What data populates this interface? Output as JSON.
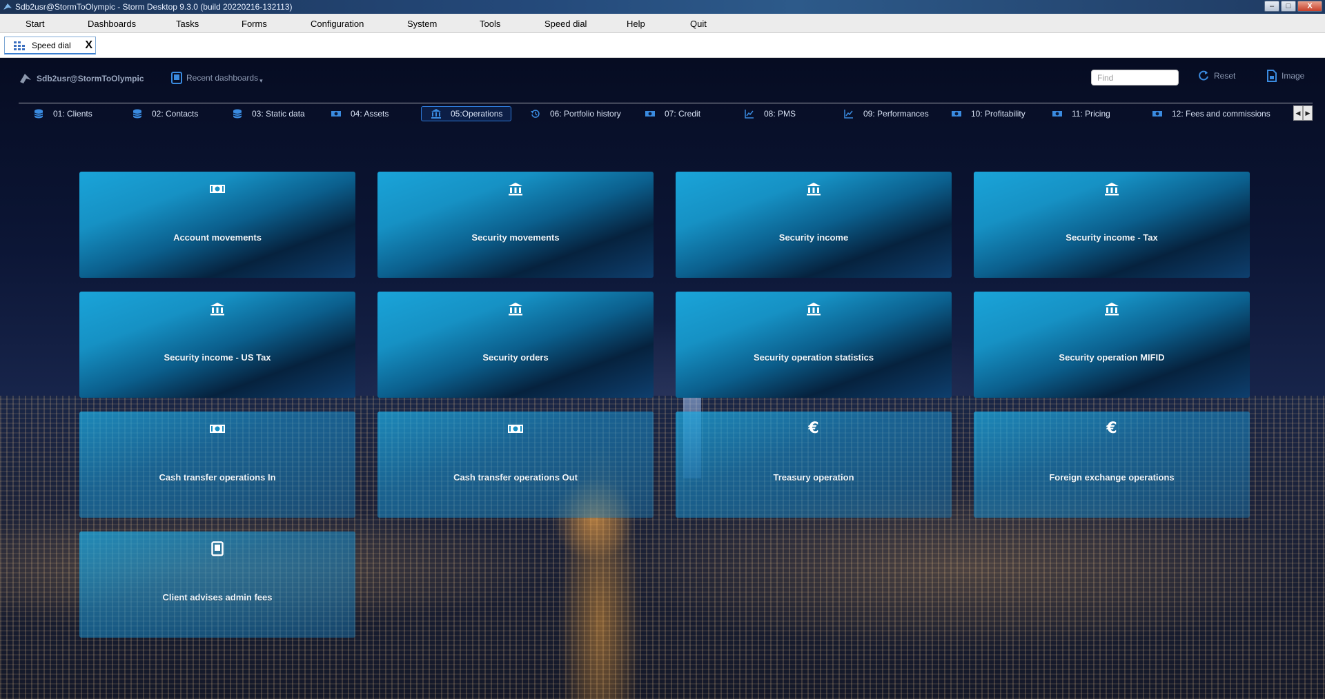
{
  "window": {
    "title": "Sdb2usr@StormToOlympic -  Storm Desktop 9.3.0 (build 20220216-132113)",
    "controls": {
      "minimize": "–",
      "maximize": "□",
      "close": "X"
    }
  },
  "menu": {
    "items": [
      "Start",
      "Dashboards",
      "Tasks",
      "Forms",
      "Configuration",
      "System",
      "Tools",
      "Speed dial",
      "Help",
      "Quit"
    ]
  },
  "doc_tab": {
    "label": "Speed dial",
    "close": "X"
  },
  "header": {
    "user": "Sdb2usr@StormToOlympic",
    "recent_dashboards": "Recent dashboards",
    "find_placeholder": "Find",
    "reset": "Reset",
    "image": "Image"
  },
  "dashboard_tabs": [
    {
      "label": "01: Clients",
      "icon": "database-icon"
    },
    {
      "label": "02: Contacts",
      "icon": "database-icon"
    },
    {
      "label": "03: Static data",
      "icon": "database-icon"
    },
    {
      "label": "04: Assets",
      "icon": "money-icon"
    },
    {
      "label": "05:Operations",
      "icon": "bank-icon",
      "active": true
    },
    {
      "label": "06: Portfolio history",
      "icon": "history-icon"
    },
    {
      "label": "07: Credit",
      "icon": "money-icon"
    },
    {
      "label": "08: PMS",
      "icon": "chart-icon"
    },
    {
      "label": "09: Performances",
      "icon": "chart-icon"
    },
    {
      "label": "10: Profitability",
      "icon": "money-icon"
    },
    {
      "label": "11: Pricing",
      "icon": "money-icon"
    },
    {
      "label": "12: Fees and commissions",
      "icon": "money-icon"
    }
  ],
  "tiles": [
    {
      "label": "Account movements",
      "icon": "money-icon"
    },
    {
      "label": "Security movements",
      "icon": "bank-icon"
    },
    {
      "label": "Security income",
      "icon": "bank-icon"
    },
    {
      "label": "Security income - Tax",
      "icon": "bank-icon"
    },
    {
      "label": "Security income - US Tax",
      "icon": "bank-icon"
    },
    {
      "label": "Security orders",
      "icon": "bank-icon"
    },
    {
      "label": "Security operation statistics",
      "icon": "bank-icon"
    },
    {
      "label": "Security operation MIFID",
      "icon": "bank-icon"
    },
    {
      "label": "Cash transfer operations In",
      "icon": "money-icon"
    },
    {
      "label": "Cash transfer operations Out",
      "icon": "money-icon"
    },
    {
      "label": "Treasury operation",
      "icon": "euro-icon"
    },
    {
      "label": "Foreign exchange operations",
      "icon": "euro-icon"
    },
    {
      "label": "Client advises admin fees",
      "icon": "tablet-icon"
    }
  ],
  "colors": {
    "accent": "#2e7ad8",
    "tile_top": "#1aa4d9",
    "tile_dark": "#06223e"
  }
}
